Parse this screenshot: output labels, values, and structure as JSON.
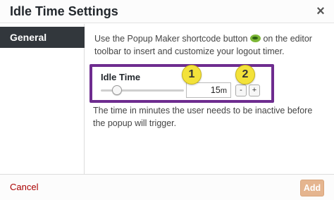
{
  "dialog": {
    "title": "Idle Time Settings",
    "close_glyph": "×"
  },
  "sidebar": {
    "tabs": [
      {
        "label": "General",
        "active": true
      }
    ]
  },
  "main": {
    "description_before": "Use the Popup Maker shortcode button",
    "description_after": "on the editor toolbar to insert and customize your logout timer.",
    "shortcode_icon": "popup-maker-icon",
    "field": {
      "label": "Idle Time",
      "value": "15",
      "unit": "m",
      "slider_fraction": 0.15,
      "decrement_label": "-",
      "increment_label": "+"
    },
    "help_text": "The time in minutes the user needs to be inactive before the popup will trigger.",
    "callouts": [
      "1",
      "2"
    ],
    "highlight_color": "#6e2c8f"
  },
  "footer": {
    "cancel_label": "Cancel",
    "add_label": "Add",
    "add_color": "#e5b58f",
    "cancel_color": "#aa0000"
  }
}
